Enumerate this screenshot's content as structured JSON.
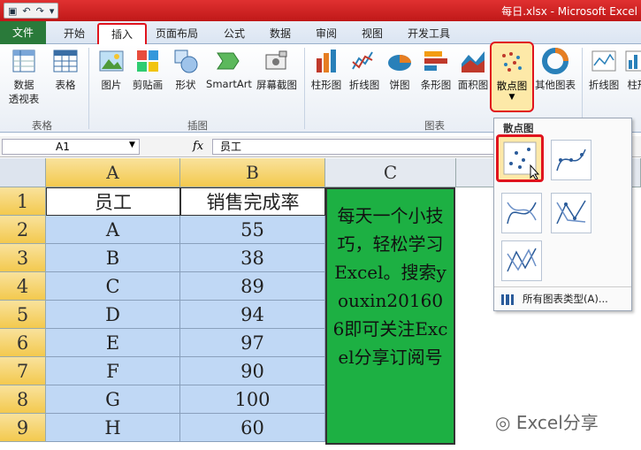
{
  "window": {
    "title": "每日.xlsx - Microsoft Excel"
  },
  "tabs": {
    "file": "文件",
    "items": [
      {
        "label": "开始"
      },
      {
        "label": "插入"
      },
      {
        "label": "页面布局"
      },
      {
        "label": "公式"
      },
      {
        "label": "数据"
      },
      {
        "label": "审阅"
      },
      {
        "label": "视图"
      },
      {
        "label": "开发工具"
      }
    ],
    "active": "插入"
  },
  "ribbon": {
    "groups": {
      "tables": "表格",
      "illustrations": "插图",
      "charts": "图表"
    },
    "buttons": {
      "pivot_line1": "数据",
      "pivot_line2": "透视表",
      "table": "表格",
      "picture": "图片",
      "clipart": "剪贴画",
      "shapes": "形状",
      "smartart": "SmartArt",
      "screenshot": "屏幕截图",
      "column": "柱形图",
      "line": "折线图",
      "pie": "饼图",
      "bar": "条形图",
      "area": "面积图",
      "scatter": "散点图",
      "other": "其他图表",
      "spark_line": "折线图",
      "spark_column": "柱形"
    }
  },
  "formula_bar": {
    "name_box": "A1",
    "fx": "fx",
    "value": "员工"
  },
  "sheet": {
    "columns": [
      "A",
      "B",
      "C"
    ],
    "rows": [
      "1",
      "2",
      "3",
      "4",
      "5",
      "6",
      "7",
      "8",
      "9"
    ],
    "header": {
      "a": "员工",
      "b": "销售完成率"
    },
    "data": [
      {
        "a": "A",
        "b": "55"
      },
      {
        "a": "B",
        "b": "38"
      },
      {
        "a": "C",
        "b": "89"
      },
      {
        "a": "D",
        "b": "94"
      },
      {
        "a": "E",
        "b": "97"
      },
      {
        "a": "F",
        "b": "90"
      },
      {
        "a": "G",
        "b": "100"
      },
      {
        "a": "H",
        "b": "60"
      }
    ],
    "note": "每天一个小技巧，轻松学习Excel。搜索youxin201606即可关注Excel分享订阅号"
  },
  "scatter_dropdown": {
    "title": "散点图",
    "all_types": "所有图表类型(A)..."
  },
  "watermark": "Excel分享",
  "colors": {
    "accent": "#e0141e",
    "file_tab": "#2a7a3a",
    "note_bg": "#1db043",
    "selection": "#c0d8f5"
  }
}
